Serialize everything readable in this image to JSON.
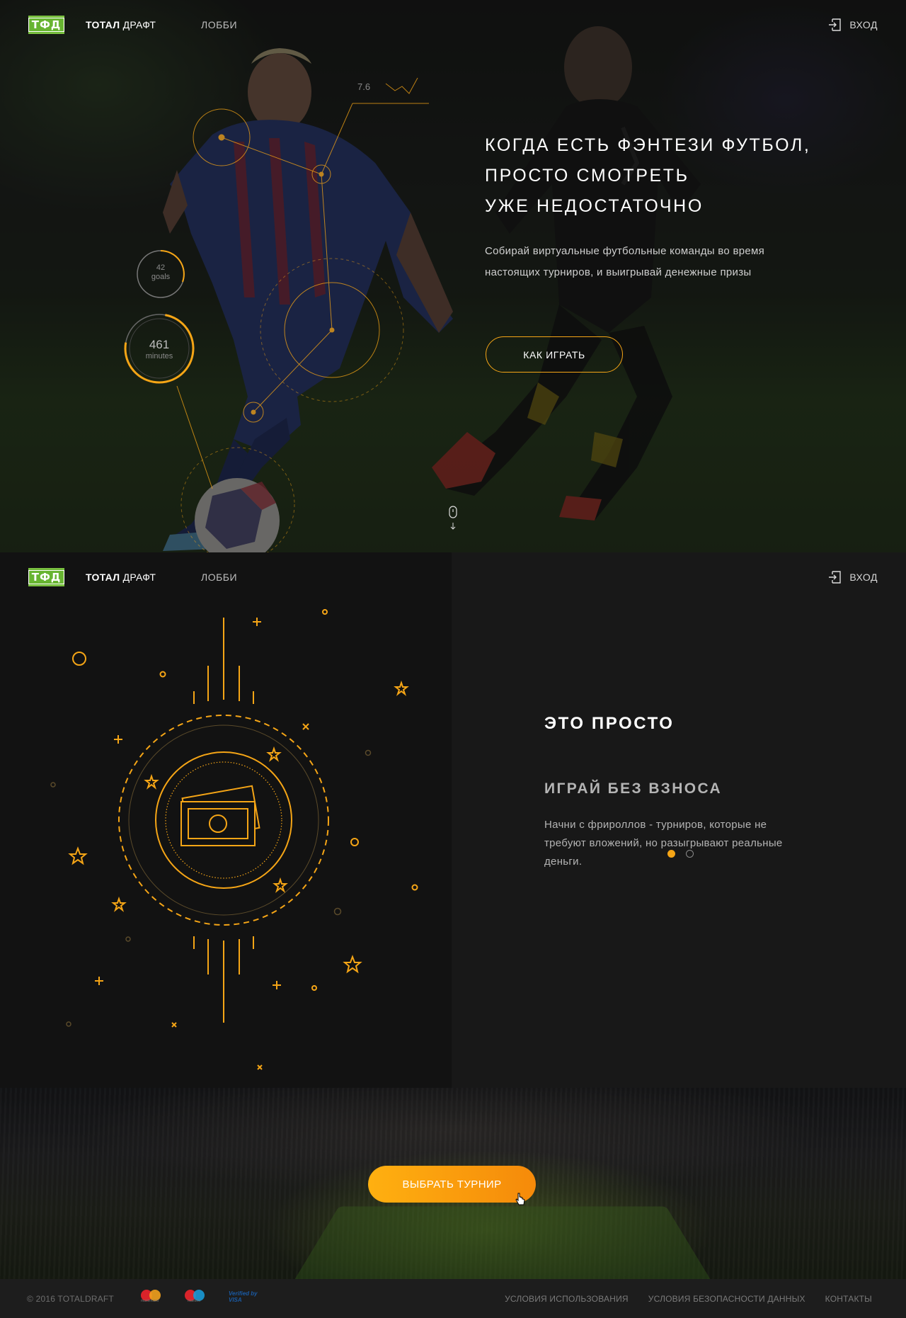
{
  "header": {
    "logo_text": "ТФД",
    "brand_bold": "ТОТАЛ",
    "brand_rest": " ДРАФТ",
    "nav_lobby": "ЛОББИ",
    "login": "ВХОД"
  },
  "hero": {
    "title_lines": [
      "КОГДА ЕСТЬ ФЭНТЕЗИ ФУТБОЛ,",
      "ПРОСТО СМОТРЕТЬ",
      "УЖЕ НЕДОСТАТОЧНО"
    ],
    "subtitle": "Собирай виртуальные футбольные команды во время настоящих турниров, и выигрывай денежные призы",
    "button": "КАК ИГРАТЬ",
    "stats": {
      "rating": "7.6",
      "goals_value": "42",
      "goals_label": "goals",
      "minutes_value": "461",
      "minutes_label": "minutes"
    },
    "accent_color": "#f5a516"
  },
  "section2": {
    "title": "ЭТО ПРОСТО",
    "subtitle": "ИГРАЙ БЕЗ ВЗНОСА",
    "text": "Начни с фрироллов - турниров, которые не требуют вложений, но разыгрывают реальные деньги.",
    "slides_total": 2,
    "slide_active": 1
  },
  "cta": {
    "button": "ВЫБРАТЬ ТУРНИР"
  },
  "footer": {
    "copyright": "© 2016 TOTALDRAFT",
    "payments": [
      {
        "icon": "mastercard-icon",
        "label": "mastercard"
      },
      {
        "icon": "maestro-icon",
        "label": "maestro"
      },
      {
        "icon": "verified-by-visa-icon",
        "label": "Verified by VISA"
      }
    ],
    "links": [
      "УСЛОВИЯ ИСПОЛЬЗОВАНИЯ",
      "УСЛОВИЯ БЕЗОПАСНОСТИ ДАННЫХ",
      "КОНТАКТЫ"
    ]
  }
}
